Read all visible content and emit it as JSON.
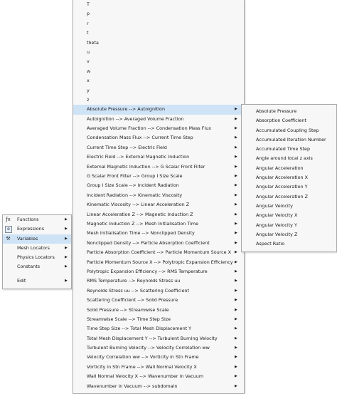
{
  "left_menu": {
    "items": [
      {
        "label": "Functions",
        "icon": "function-icon",
        "has_submenu": true
      },
      {
        "label": "Expressions",
        "icon": "expression-icon",
        "has_submenu": true
      },
      {
        "label": "Variables",
        "icon": "variables-icon",
        "has_submenu": true,
        "highlighted": true
      },
      {
        "label": "Mesh Locators",
        "icon": "",
        "has_submenu": true
      },
      {
        "label": "Physics Locators",
        "icon": "",
        "has_submenu": true
      },
      {
        "label": "Constants",
        "icon": "",
        "has_submenu": true
      },
      {
        "label": "Edit",
        "icon": "",
        "has_submenu": true
      }
    ]
  },
  "variables_menu": {
    "single_letters": [
      "T",
      "p",
      "r",
      "t",
      "theta",
      "u",
      "v",
      "w",
      "x",
      "y",
      "z"
    ],
    "ranges": [
      {
        "label": "Absolute Pressure  -->  Autoignition",
        "highlighted": true
      },
      {
        "label": "Autoignition  -->  Averaged Volume Fraction"
      },
      {
        "label": "Averaged Volume Fraction  -->  Condensation Mass Flux"
      },
      {
        "label": "Condensation Mass Flux  -->  Current Time Step"
      },
      {
        "label": "Current Time Step  -->  Electric Field"
      },
      {
        "label": "Electric Field  -->  External Magnetic Induction"
      },
      {
        "label": "External Magnetic Induction  -->  G Scalar Front Filter"
      },
      {
        "label": "G Scalar Front Filter  -->  Group I Size Scale"
      },
      {
        "label": "Group I Size Scale  -->  Incident Radiation"
      },
      {
        "label": "Incident Radiation  -->  Kinematic Viscosity"
      },
      {
        "label": "Kinematic Viscosity  -->  Linear Acceleration Z"
      },
      {
        "label": "Linear Acceleration Z  -->  Magnetic Induction Z"
      },
      {
        "label": "Magnetic Induction Z  -->  Mesh Initialisation Time"
      },
      {
        "label": "Mesh Initialisation Time  -->  Nonclipped Density"
      },
      {
        "label": "Nonclipped Density  -->  Particle Absorption Coefficient"
      },
      {
        "label": "Particle Absorption Coefficient  -->  Particle Momentum Source X"
      },
      {
        "label": "Particle Momentum Source X  -->  Polytropic Expansion Efficiency"
      },
      {
        "label": "Polytropic Expansion Efficiency  -->  RMS Temperature"
      },
      {
        "label": "RMS Temperature  -->  Reynolds Stress uu"
      },
      {
        "label": "Reynolds Stress uu  -->  Scattering Coefficient"
      },
      {
        "label": "Scattering Coefficient  -->  Solid Pressure"
      },
      {
        "label": "Solid Pressure  -->  Streamwise Scale"
      },
      {
        "label": "Streamwise Scale  -->  Time Step Size"
      },
      {
        "label": "Time Step Size  -->  Total Mesh Displacement Y"
      },
      {
        "label": "Total Mesh Displacement Y  -->  Turbulent Burning Velocity"
      },
      {
        "label": "Turbulent Burning Velocity  -->  Velocity Correlation ww"
      },
      {
        "label": "Velocity Correlation ww  -->  Vorticity in Stn Frame"
      },
      {
        "label": "Vorticity in Stn Frame  -->  Wall Normal Velocity X"
      },
      {
        "label": "Wall Normal Velocity X  -->  Wavenumber in Vacuum"
      },
      {
        "label": "Wavenumber in Vacuum  -->  subdomain"
      }
    ]
  },
  "sub_menu": {
    "items": [
      "Absolute Pressure",
      "Absorption Coefficient",
      "Accumulated Coupling Step",
      "Accumulated Iteration Number",
      "Accumulated Time Step",
      "Angle around local z axis",
      "Angular Acceleration",
      "Angular Acceleration X",
      "Angular Acceleration Y",
      "Angular Acceleration Z",
      "Angular Velocity",
      "Angular Velocity X",
      "Angular Velocity Y",
      "Angular Velocity Z",
      "Aspect Ratio"
    ]
  },
  "colors": {
    "menu_bg": "#f7f7f7",
    "menu_border": "#a8a8a8",
    "highlight": "#cfe3f7",
    "text": "#1a1a1a"
  }
}
